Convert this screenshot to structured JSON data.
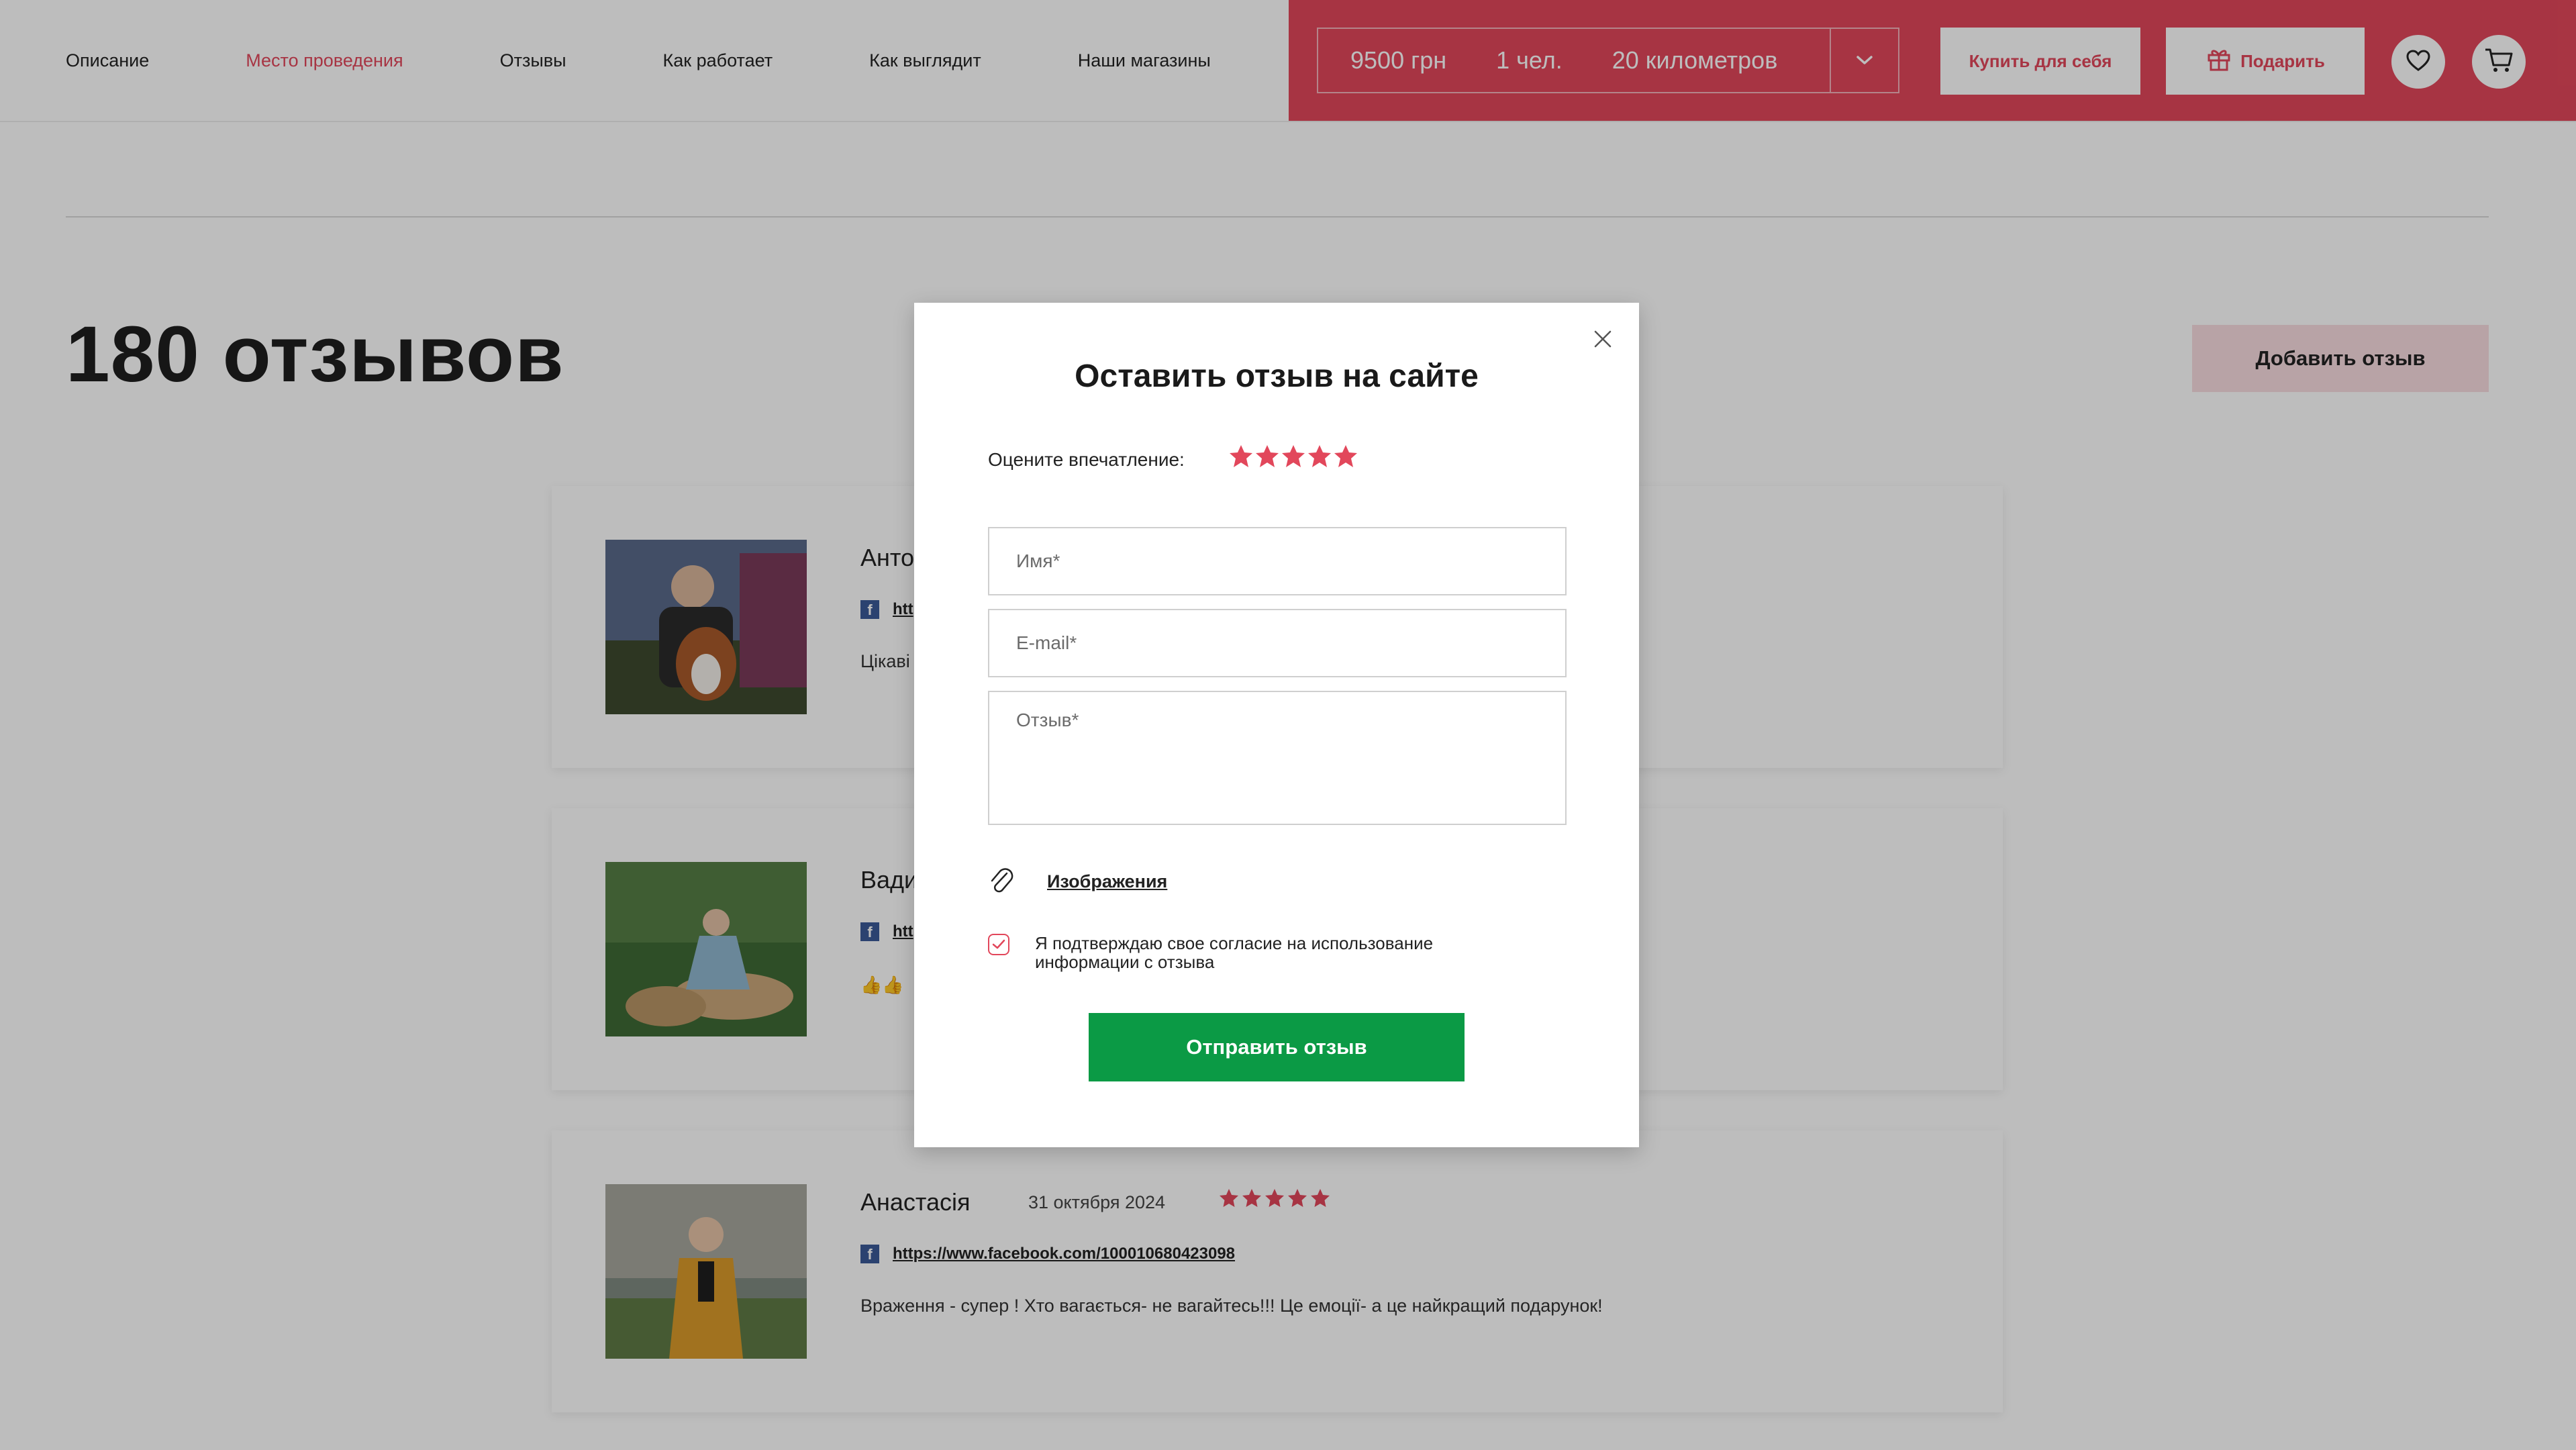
{
  "nav": {
    "items": [
      "Описание",
      "Место проведения",
      "Отзывы",
      "Как работает",
      "Как выглядит",
      "Наши магазины"
    ],
    "active_index": 1
  },
  "selector": {
    "price": "9500 грн",
    "people": "1 чел.",
    "distance": "20 километров"
  },
  "header_buttons": {
    "buy": "Купить для себя",
    "gift": "Подарить"
  },
  "reviews": {
    "count_title": "180 отзывов",
    "add_button": "Добавить отзыв",
    "items": [
      {
        "name": "Анто",
        "link": "htt",
        "text": "Цікаві"
      },
      {
        "name": "Вади",
        "link": "htt",
        "text": "👍👍"
      },
      {
        "name": "Анастасія",
        "date": "31 октября 2024",
        "link": "https://www.facebook.com/100010680423098",
        "text": "Враження - супер ! Хто вагається- не вагайтесь!!! Це емоції- а це найкращий подарунок!",
        "rating": 5
      }
    ]
  },
  "modal": {
    "title": "Оставить отзыв на сайте",
    "rate_label": "Оцените впечатление:",
    "rating": 5,
    "name_placeholder": "Имя*",
    "email_placeholder": "E-mail*",
    "review_placeholder": "Отзыв*",
    "attach_label": "Изображения",
    "consent_text": "Я подтверждаю свое согласие на использование информации с отзыва",
    "consent_checked": true,
    "submit_label": "Отправить отзыв"
  },
  "colors": {
    "accent": "#e2475b",
    "submit": "#0b9a45",
    "facebook": "#3b5998"
  }
}
